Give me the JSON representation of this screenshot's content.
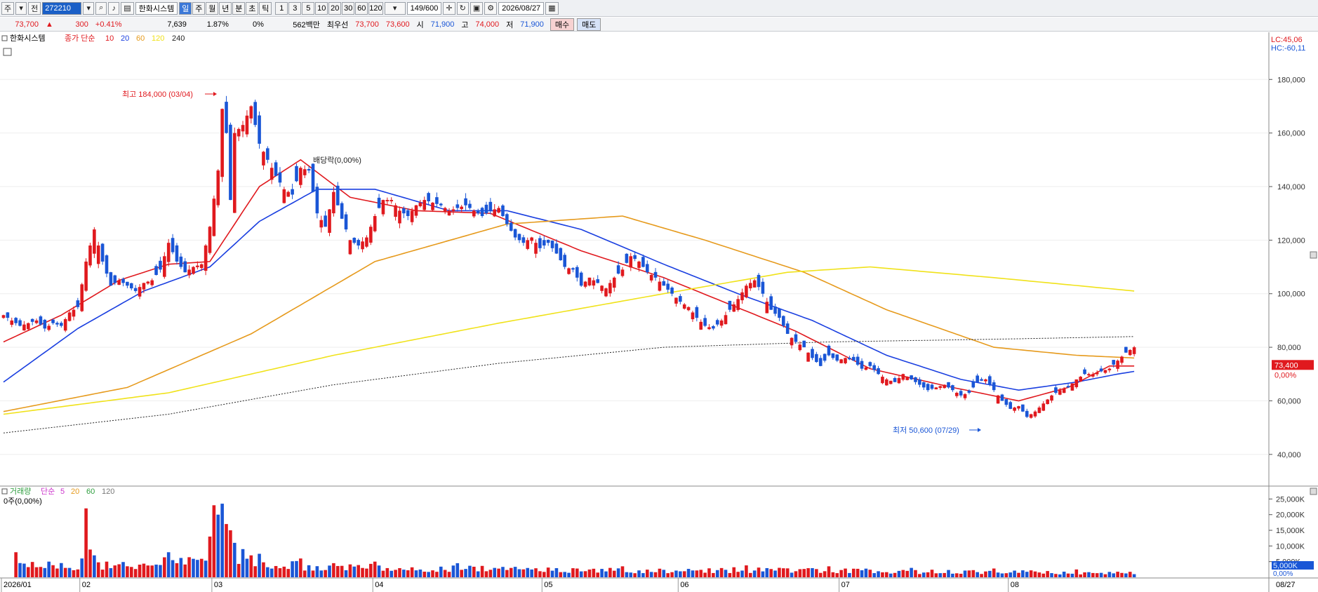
{
  "toolbar": {
    "market": "주",
    "scope": "전",
    "code": "272210",
    "stock_name": "한화시스템",
    "periods": [
      "일",
      "주",
      "월",
      "년",
      "분",
      "초",
      "틱"
    ],
    "active_period": "일",
    "intervals": [
      "1",
      "3",
      "5",
      "10",
      "20",
      "30",
      "60",
      "120"
    ],
    "count": "149",
    "count_max": "/600",
    "date": "2026/08/27"
  },
  "quote": {
    "price": "73,700",
    "arrow": "▲",
    "change": "300",
    "change_pct": "+0.41%",
    "volume": "7,639",
    "turnover_pct": "1.87%",
    "volume_change": "0%",
    "amount": "562백만",
    "best_label": "최우선",
    "ask": "73,700",
    "bid": "73,600",
    "open_label": "시",
    "open": "71,900",
    "high_label": "고",
    "high": "74,000",
    "low_label": "저",
    "low": "71,900",
    "buy": "매수",
    "sell": "매도"
  },
  "price_legend": {
    "name": "한화시스템",
    "ma_label": "종가 단순",
    "periods": [
      "10",
      "20",
      "60",
      "120",
      "240"
    ],
    "colors": [
      "#e0191e",
      "#1a3fe0",
      "#e69a1c",
      "#f0e21a",
      "#222222"
    ]
  },
  "volume_legend": {
    "name": "거래량",
    "ma_label": "단순",
    "periods": [
      "5",
      "20",
      "60",
      "120"
    ],
    "colors": [
      "#cc33cc",
      "#e69a1c",
      "#2e9e3e",
      "#777777"
    ],
    "value": "0주(0,00%)"
  },
  "right_labels": {
    "lc": "LC:45,06",
    "hc": "HC:-60,11",
    "last_price": "73,400",
    "last_pct": "0,00%",
    "vol_last": "5,000K",
    "vol_pct": "0,00%",
    "date_label": "08/27"
  },
  "annotations": {
    "high": "최고 184,000 (03/04)",
    "low": "최저 50,600 (07/29)",
    "dividend": "배당락(0,00%)"
  },
  "colors": {
    "up": "#e0191e",
    "down": "#1a56d6",
    "bg": "#ffffff",
    "grid": "#d0d0d0"
  },
  "chart_data": {
    "type": "candlestick",
    "price_ylim": [
      30000,
      195000
    ],
    "price_ticks": [
      "40,000",
      "60,000",
      "80,000",
      "100,000",
      "120,000",
      "140,000",
      "160,000",
      "180,000"
    ],
    "volume_ylim": [
      0,
      28000
    ],
    "volume_ticks": [
      "5,000K",
      "10,000K",
      "15,000K",
      "20,000K",
      "25,000K"
    ],
    "x_labels": [
      {
        "label": "2026/01",
        "i": 0
      },
      {
        "label": "02",
        "i": 19
      },
      {
        "label": "03",
        "i": 51
      },
      {
        "label": "04",
        "i": 90
      },
      {
        "label": "05",
        "i": 131
      },
      {
        "label": "06",
        "i": 164
      },
      {
        "label": "07",
        "i": 203
      },
      {
        "label": "08",
        "i": 244
      }
    ],
    "n": 275,
    "anchors_close": [
      [
        0,
        92000
      ],
      [
        2,
        90000
      ],
      [
        4,
        88000
      ],
      [
        6,
        89000
      ],
      [
        8,
        90000
      ],
      [
        10,
        87000
      ],
      [
        12,
        89000
      ],
      [
        14,
        88000
      ],
      [
        16,
        93000
      ],
      [
        18,
        95000
      ],
      [
        20,
        112000
      ],
      [
        22,
        124000
      ],
      [
        24,
        112000
      ],
      [
        26,
        103000
      ],
      [
        28,
        105000
      ],
      [
        30,
        103000
      ],
      [
        32,
        101000
      ],
      [
        34,
        104000
      ],
      [
        36,
        105000
      ],
      [
        38,
        109000
      ],
      [
        40,
        119000
      ],
      [
        42,
        112000
      ],
      [
        44,
        108000
      ],
      [
        46,
        110000
      ],
      [
        48,
        111000
      ],
      [
        50,
        125000
      ],
      [
        52,
        146000
      ],
      [
        53,
        169000
      ],
      [
        54,
        160000
      ],
      [
        55,
        135000
      ],
      [
        56,
        160000
      ],
      [
        58,
        163000
      ],
      [
        60,
        170000
      ],
      [
        62,
        156000
      ],
      [
        64,
        150000
      ],
      [
        66,
        144000
      ],
      [
        68,
        139000
      ],
      [
        70,
        137000
      ],
      [
        72,
        147000
      ],
      [
        74,
        146000
      ],
      [
        76,
        130000
      ],
      [
        78,
        125000
      ],
      [
        80,
        138000
      ],
      [
        82,
        128000
      ],
      [
        84,
        120000
      ],
      [
        86,
        118000
      ],
      [
        88,
        121000
      ],
      [
        90,
        129000
      ],
      [
        92,
        135000
      ],
      [
        94,
        135000
      ],
      [
        96,
        131000
      ],
      [
        98,
        129000
      ],
      [
        100,
        133000
      ],
      [
        102,
        135000
      ],
      [
        104,
        134000
      ],
      [
        106,
        133000
      ],
      [
        108,
        131000
      ],
      [
        110,
        132000
      ],
      [
        112,
        133000
      ],
      [
        114,
        131000
      ],
      [
        116,
        129000
      ],
      [
        118,
        131000
      ],
      [
        120,
        132000
      ],
      [
        122,
        126000
      ],
      [
        124,
        121000
      ],
      [
        126,
        119000
      ],
      [
        128,
        121000
      ],
      [
        130,
        117000
      ],
      [
        132,
        119000
      ],
      [
        134,
        115000
      ],
      [
        136,
        110000
      ],
      [
        138,
        109000
      ],
      [
        140,
        103000
      ],
      [
        142,
        106000
      ],
      [
        144,
        104000
      ],
      [
        146,
        102000
      ],
      [
        148,
        106000
      ],
      [
        150,
        109000
      ],
      [
        152,
        114000
      ],
      [
        154,
        112000
      ],
      [
        156,
        108000
      ],
      [
        158,
        106000
      ],
      [
        160,
        103000
      ],
      [
        162,
        100000
      ],
      [
        164,
        97000
      ],
      [
        166,
        95000
      ],
      [
        168,
        91000
      ],
      [
        170,
        88000
      ],
      [
        172,
        87000
      ],
      [
        174,
        90000
      ],
      [
        176,
        94000
      ],
      [
        178,
        98000
      ],
      [
        180,
        103000
      ],
      [
        182,
        105000
      ],
      [
        184,
        100000
      ],
      [
        186,
        94000
      ],
      [
        188,
        91000
      ],
      [
        190,
        85000
      ],
      [
        192,
        82000
      ],
      [
        194,
        80000
      ],
      [
        196,
        76000
      ],
      [
        198,
        73000
      ],
      [
        200,
        77000
      ],
      [
        202,
        75000
      ],
      [
        204,
        76000
      ],
      [
        206,
        75000
      ],
      [
        208,
        72000
      ],
      [
        210,
        73000
      ],
      [
        212,
        70000
      ],
      [
        214,
        68000
      ],
      [
        216,
        67000
      ],
      [
        218,
        70000
      ],
      [
        220,
        68000
      ],
      [
        222,
        66000
      ],
      [
        224,
        64000
      ],
      [
        226,
        65000
      ],
      [
        228,
        66000
      ],
      [
        230,
        64000
      ],
      [
        232,
        62000
      ],
      [
        234,
        63000
      ],
      [
        236,
        67000
      ],
      [
        238,
        68000
      ],
      [
        240,
        64000
      ],
      [
        242,
        60000
      ],
      [
        244,
        57000
      ],
      [
        246,
        58000
      ],
      [
        248,
        54000
      ],
      [
        250,
        56000
      ],
      [
        252,
        59000
      ],
      [
        254,
        62000
      ],
      [
        256,
        64000
      ],
      [
        258,
        65000
      ],
      [
        260,
        68000
      ],
      [
        262,
        70000
      ],
      [
        264,
        70000
      ],
      [
        266,
        71000
      ],
      [
        268,
        72000
      ],
      [
        270,
        75000
      ],
      [
        272,
        78000
      ],
      [
        274,
        80000
      ]
    ],
    "ma_anchors": {
      "ma10": [
        [
          0,
          82000
        ],
        [
          14,
          92000
        ],
        [
          28,
          105000
        ],
        [
          40,
          111000
        ],
        [
          50,
          112000
        ],
        [
          62,
          140000
        ],
        [
          72,
          150000
        ],
        [
          84,
          136000
        ],
        [
          100,
          131000
        ],
        [
          118,
          130000
        ],
        [
          140,
          116000
        ],
        [
          160,
          106000
        ],
        [
          176,
          96000
        ],
        [
          192,
          86000
        ],
        [
          210,
          72000
        ],
        [
          230,
          65000
        ],
        [
          246,
          60000
        ],
        [
          258,
          65000
        ],
        [
          268,
          73000
        ],
        [
          274,
          73000
        ]
      ],
      "ma20": [
        [
          0,
          67000
        ],
        [
          18,
          87000
        ],
        [
          34,
          101000
        ],
        [
          50,
          110000
        ],
        [
          62,
          127000
        ],
        [
          76,
          139000
        ],
        [
          90,
          139000
        ],
        [
          108,
          131000
        ],
        [
          122,
          131000
        ],
        [
          140,
          124000
        ],
        [
          160,
          111000
        ],
        [
          178,
          100000
        ],
        [
          196,
          90000
        ],
        [
          214,
          77000
        ],
        [
          232,
          68000
        ],
        [
          246,
          64000
        ],
        [
          260,
          67000
        ],
        [
          270,
          70000
        ],
        [
          274,
          71000
        ]
      ],
      "ma60": [
        [
          0,
          56000
        ],
        [
          30,
          65000
        ],
        [
          60,
          85000
        ],
        [
          90,
          112000
        ],
        [
          122,
          126000
        ],
        [
          150,
          129000
        ],
        [
          170,
          120000
        ],
        [
          194,
          108000
        ],
        [
          214,
          94000
        ],
        [
          240,
          80000
        ],
        [
          260,
          77000
        ],
        [
          274,
          76000
        ]
      ],
      "ma120": [
        [
          0,
          55000
        ],
        [
          40,
          63000
        ],
        [
          80,
          77000
        ],
        [
          120,
          89000
        ],
        [
          160,
          100000
        ],
        [
          190,
          108000
        ],
        [
          210,
          110000
        ],
        [
          240,
          106000
        ],
        [
          274,
          101000
        ]
      ],
      "ma240": [
        [
          0,
          48000
        ],
        [
          40,
          55000
        ],
        [
          80,
          66000
        ],
        [
          120,
          74000
        ],
        [
          160,
          80000
        ],
        [
          200,
          82000
        ],
        [
          240,
          83000
        ],
        [
          274,
          84000
        ]
      ]
    },
    "volume_spikes": [
      [
        3,
        8000
      ],
      [
        11,
        5000
      ],
      [
        19,
        6000
      ],
      [
        20,
        22000
      ],
      [
        22,
        7000
      ],
      [
        25,
        5000
      ],
      [
        40,
        8000
      ],
      [
        50,
        13000
      ],
      [
        51,
        23000
      ],
      [
        52,
        20000
      ],
      [
        53,
        23500
      ],
      [
        54,
        17000
      ],
      [
        55,
        15000
      ],
      [
        56,
        11000
      ],
      [
        58,
        9000
      ],
      [
        60,
        7000
      ],
      [
        62,
        7500
      ],
      [
        72,
        6000
      ],
      [
        90,
        5000
      ],
      [
        110,
        4500
      ],
      [
        150,
        3500
      ],
      [
        180,
        3800
      ],
      [
        200,
        3500
      ],
      [
        220,
        3000
      ],
      [
        240,
        2800
      ],
      [
        260,
        2500
      ]
    ]
  }
}
